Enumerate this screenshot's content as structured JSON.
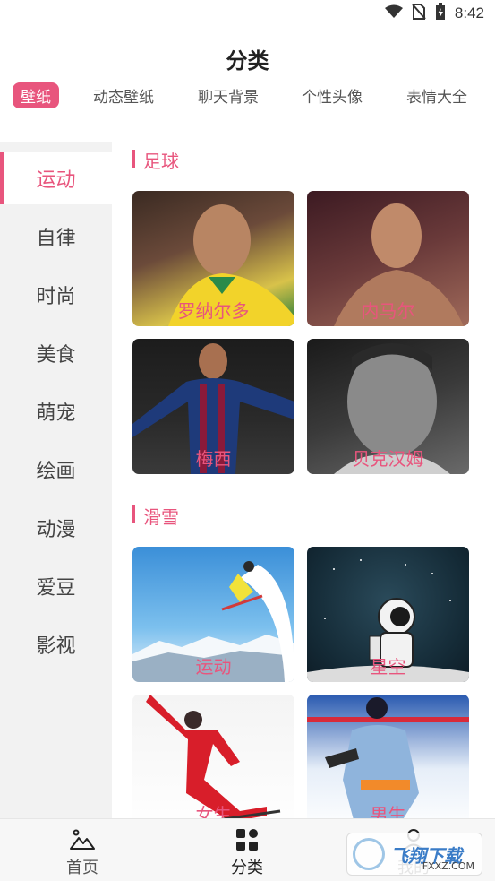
{
  "status_bar": {
    "time": "8:42",
    "icons": [
      "wifi-icon",
      "no-sim-icon",
      "battery-charging-icon"
    ]
  },
  "page_title": "分类",
  "top_tabs": [
    {
      "label": "壁纸",
      "active": true
    },
    {
      "label": "动态壁纸",
      "active": false
    },
    {
      "label": "聊天背景",
      "active": false
    },
    {
      "label": "个性头像",
      "active": false
    },
    {
      "label": "表情大全",
      "active": false
    }
  ],
  "sidebar": {
    "items": [
      {
        "label": "运动",
        "active": true
      },
      {
        "label": "自律",
        "active": false
      },
      {
        "label": "时尚",
        "active": false
      },
      {
        "label": "美食",
        "active": false
      },
      {
        "label": "萌宠",
        "active": false
      },
      {
        "label": "绘画",
        "active": false
      },
      {
        "label": "动漫",
        "active": false
      },
      {
        "label": "爱豆",
        "active": false
      },
      {
        "label": "影视",
        "active": false
      }
    ]
  },
  "sections": [
    {
      "title": "足球",
      "cards": [
        {
          "label": "罗纳尔多"
        },
        {
          "label": "内马尔"
        },
        {
          "label": "梅西"
        },
        {
          "label": "贝克汉姆"
        }
      ]
    },
    {
      "title": "滑雪",
      "cards": [
        {
          "label": "运动"
        },
        {
          "label": "星空"
        },
        {
          "label": "女生"
        },
        {
          "label": "男生"
        }
      ]
    }
  ],
  "bottom_nav": [
    {
      "label": "首页",
      "icon": "mountain-icon",
      "active": false
    },
    {
      "label": "分类",
      "icon": "grid-icon",
      "active": true
    },
    {
      "label": "我的",
      "icon": "user-icon",
      "active": false
    }
  ],
  "watermark": {
    "text": "飞翔下载",
    "sub": "FXXZ.COM"
  },
  "colors": {
    "accent": "#e8557d",
    "sidebar_bg": "#f2f2f2"
  }
}
